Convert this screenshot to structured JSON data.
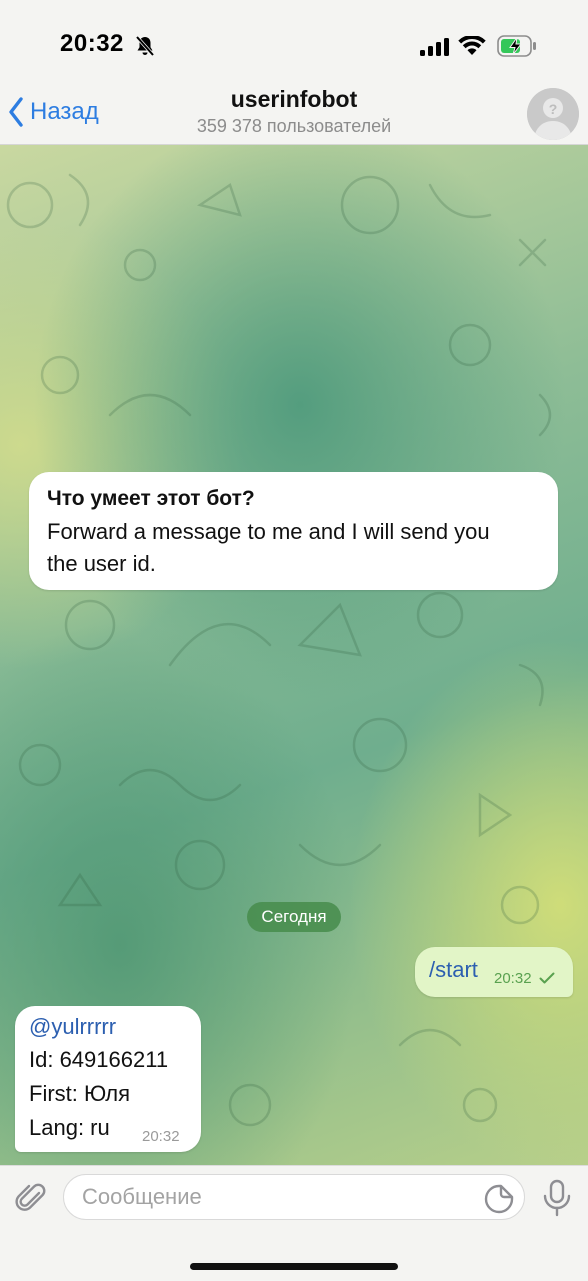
{
  "status_bar": {
    "time": "20:32",
    "icons": [
      "bell-muted-icon",
      "signal-icon",
      "wifi-icon",
      "battery-charging-icon"
    ]
  },
  "header": {
    "back_label": "Назад",
    "title": "userinfobot",
    "subtitle": "359 378 пользователей"
  },
  "chat": {
    "bot_info": {
      "title": "Что умеет этот бот?",
      "lines": [
        "Forward a message to me and I will send you",
        "the user id."
      ]
    },
    "date_chip": "Сегодня",
    "messages": [
      {
        "direction": "out",
        "text": "/start",
        "time": "20:32",
        "status": "delivered"
      },
      {
        "direction": "in",
        "lines": [
          "@yulrrrrr",
          "Id: 649166211",
          "First: Юля",
          "Lang: ru"
        ],
        "time": "20:32"
      }
    ]
  },
  "composer": {
    "placeholder": "Сообщение"
  },
  "colors": {
    "accent": "#2d7de1",
    "outgoing_bubble": "#e2f5c7",
    "date_chip": "#468c4b"
  }
}
